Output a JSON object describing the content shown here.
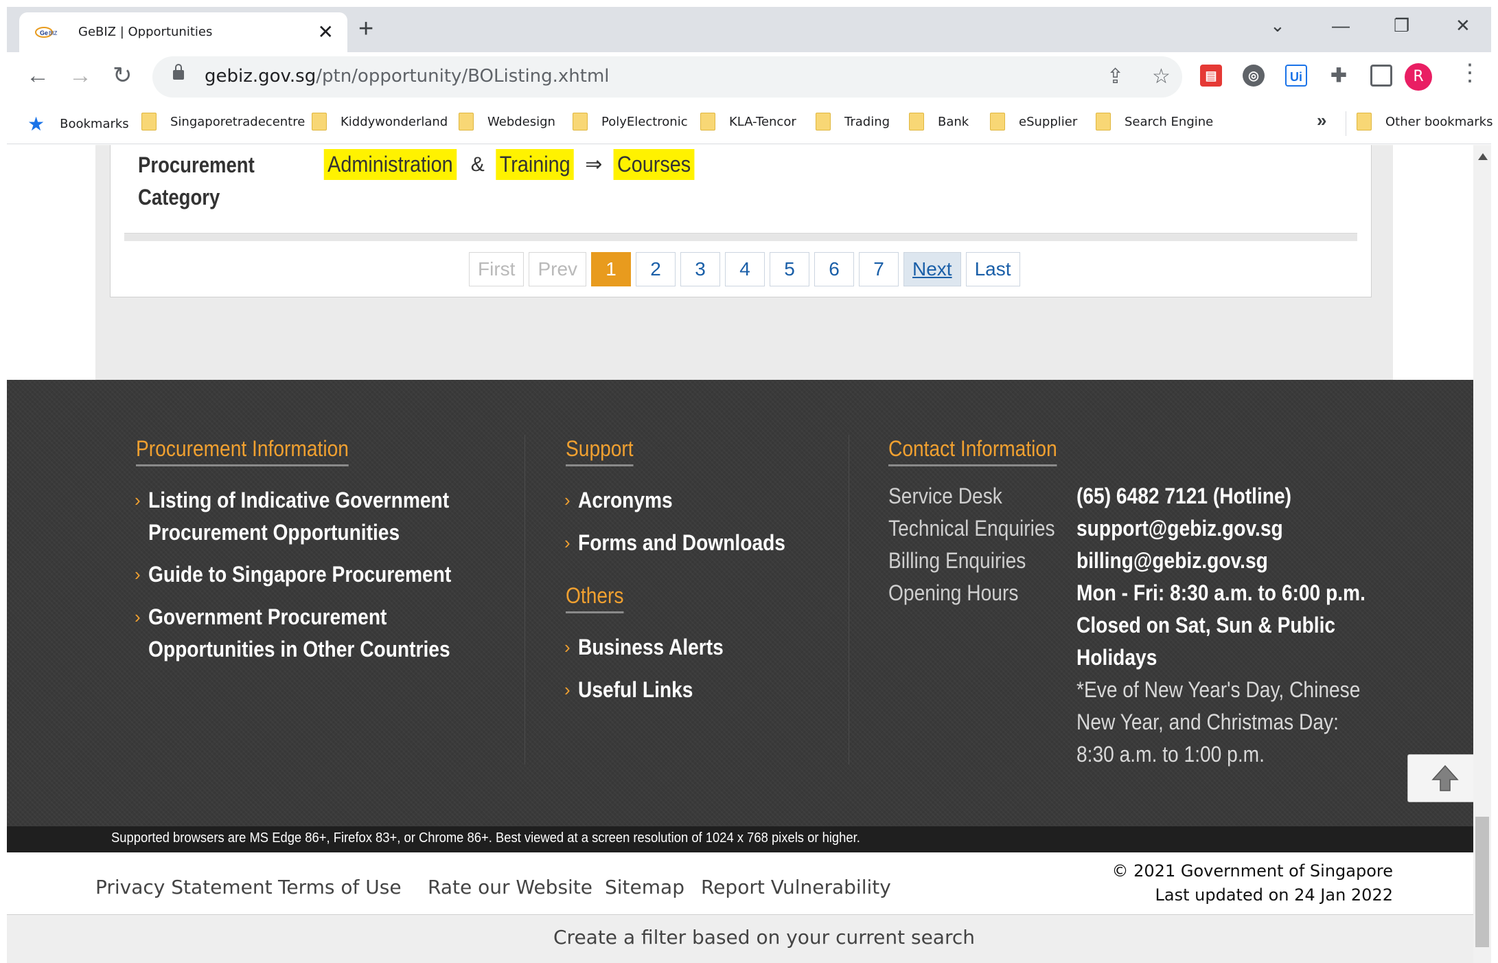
{
  "browser": {
    "tab_title": "GeBIZ | Opportunities",
    "tab_close": "✕",
    "new_tab": "+",
    "url_host": "gebiz.gov.sg",
    "url_path": "/ptn/opportunity/BOListing.xhtml",
    "back": "←",
    "forward": "→",
    "reload": "↻",
    "minimize": "—",
    "restore": "❐",
    "close": "✕",
    "tab_search": "⌄",
    "share_icon": "⇪",
    "star_icon": "☆",
    "profile_initial": "R",
    "menu": "⋮",
    "bookmarks_more": "»",
    "bookmarks": [
      {
        "label": "Bookmarks",
        "icon": "star-icon"
      },
      {
        "label": "Singaporetradecentre",
        "icon": "folder-icon"
      },
      {
        "label": "Kiddywonderland",
        "icon": "folder-icon"
      },
      {
        "label": "Webdesign",
        "icon": "folder-icon"
      },
      {
        "label": "PolyElectronic",
        "icon": "folder-icon"
      },
      {
        "label": "KLA-Tencor",
        "icon": "folder-icon"
      },
      {
        "label": "Trading",
        "icon": "folder-icon"
      },
      {
        "label": "Bank",
        "icon": "folder-icon"
      },
      {
        "label": "eSupplier",
        "icon": "folder-icon"
      },
      {
        "label": "Search Engine",
        "icon": "folder-icon"
      }
    ],
    "other_bookmarks": "Other bookmarks"
  },
  "listing": {
    "category_label": "Procurement Category",
    "category_terms": [
      "Administration",
      "&",
      "Training",
      "⇒",
      "Courses"
    ]
  },
  "pagination": {
    "first": "First",
    "prev": "Prev",
    "pages": [
      "1",
      "2",
      "3",
      "4",
      "5",
      "6",
      "7"
    ],
    "current": "1",
    "next": "Next",
    "last": "Last"
  },
  "footer": {
    "procurement": {
      "heading": "Procurement Information",
      "links": [
        [
          "Listing of Indicative Government",
          "Procurement Opportunities"
        ],
        [
          "Guide to Singapore Procurement"
        ],
        [
          "Government Procurement",
          "Opportunities in Other Countries"
        ]
      ]
    },
    "support": {
      "heading": "Support",
      "links": [
        "Acronyms",
        "Forms and Downloads"
      ]
    },
    "others": {
      "heading": "Others",
      "links": [
        "Business Alerts",
        "Useful Links"
      ]
    },
    "contact": {
      "heading": "Contact Information",
      "service_desk_label": "Service Desk",
      "service_desk_value": "(65) 6482 7121 (Hotline)",
      "technical_label": "Technical Enquiries",
      "technical_value": "support@gebiz.gov.sg",
      "billing_label": "Billing Enquiries",
      "billing_value": "billing@gebiz.gov.sg",
      "hours_label": "Opening Hours",
      "hours_lines": [
        "Mon - Fri: 8:30 a.m. to 6:00 p.m.",
        "Closed on Sat, Sun & Public",
        "Holidays"
      ],
      "hours_note_lines": [
        "*Eve of New Year's Day, Chinese",
        "New Year, and Christmas Day:",
        "8:30 a.m. to 1:00 p.m."
      ]
    },
    "browser_note": "Supported browsers are MS Edge 86+, Firefox 83+, or Chrome 86+. Best viewed at a screen resolution of 1024 x 768 pixels or higher.",
    "legal_links": [
      "Privacy Statement",
      "Terms of Use",
      "Rate our Website",
      "Sitemap",
      "Report Vulnerability"
    ],
    "copyright": "© 2021 Government of Singapore",
    "last_updated": "Last updated on 24 Jan 2022",
    "chevron": "›"
  },
  "filter_bar": {
    "label": "Create a filter based on your current search"
  },
  "colors": {
    "accent_orange": "#e89b1e",
    "highlight_yellow": "#fff200",
    "footer_dark": "#3a3a3a",
    "link_blue": "#1a5fa8"
  }
}
